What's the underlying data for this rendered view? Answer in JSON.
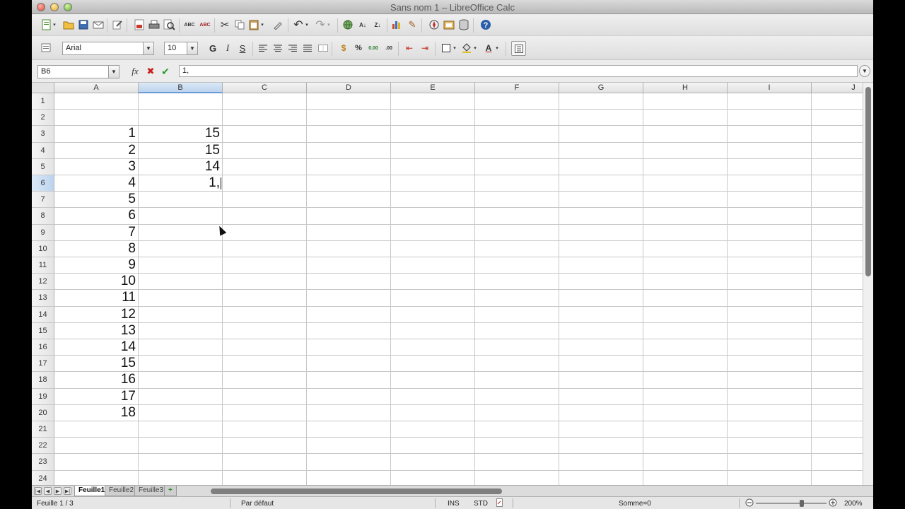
{
  "window": {
    "title": "Sans nom 1 – LibreOffice Calc"
  },
  "toolbar": {
    "icons": [
      "new-icon",
      "open-icon",
      "save-icon",
      "email-icon",
      "edit-icon",
      "pdf-icon",
      "print-icon",
      "preview-icon",
      "spellcheck-icon",
      "autospell-icon",
      "cut-icon",
      "copy-icon",
      "paste-icon",
      "clone-icon",
      "undo-icon",
      "redo-icon",
      "hyperlink-icon",
      "sort-asc-icon",
      "sort-desc-icon",
      "chart-icon",
      "draw-icon",
      "navigator-icon",
      "gallery-icon",
      "datasource-icon",
      "help-icon"
    ]
  },
  "format": {
    "font_name": "Arial",
    "font_size": "10",
    "bold": "G",
    "italic": "I",
    "underline": "S"
  },
  "formula": {
    "cell_ref": "B6",
    "fx": "fx",
    "cancel": "✖",
    "accept": "✔",
    "content": "1,"
  },
  "grid": {
    "columns": [
      "A",
      "B",
      "C",
      "D",
      "E",
      "F",
      "G",
      "H",
      "I",
      "J"
    ],
    "selected_column": "B",
    "rows": [
      "1",
      "2",
      "3",
      "4",
      "5",
      "6",
      "7",
      "8",
      "9",
      "10",
      "11",
      "12",
      "13",
      "14",
      "15",
      "16",
      "17",
      "18",
      "19",
      "20",
      "21",
      "22",
      "23",
      "24"
    ],
    "selected_row": "6",
    "col_a": [
      "",
      "",
      "1",
      "2",
      "3",
      "4",
      "5",
      "6",
      "7",
      "8",
      "9",
      "10",
      "11",
      "12",
      "13",
      "14",
      "15",
      "16",
      "17",
      "18",
      "",
      "",
      "",
      ""
    ],
    "col_b": [
      "",
      "",
      "15",
      "15",
      "14",
      "1,",
      "",
      "",
      "",
      "",
      "",
      "",
      "",
      "",
      "",
      "",
      "",
      "",
      "",
      "",
      "",
      "",
      "",
      ""
    ]
  },
  "sheets": [
    "Feuille1",
    "Feuille2",
    "Feuille3"
  ],
  "active_sheet": "Feuille1",
  "add_sheet": "+",
  "status": {
    "sheet_pos": "Feuille 1 / 3",
    "style": "Par défaut",
    "ins": "INS",
    "std": "STD",
    "sum": "Somme=0",
    "zoom": "200%"
  }
}
